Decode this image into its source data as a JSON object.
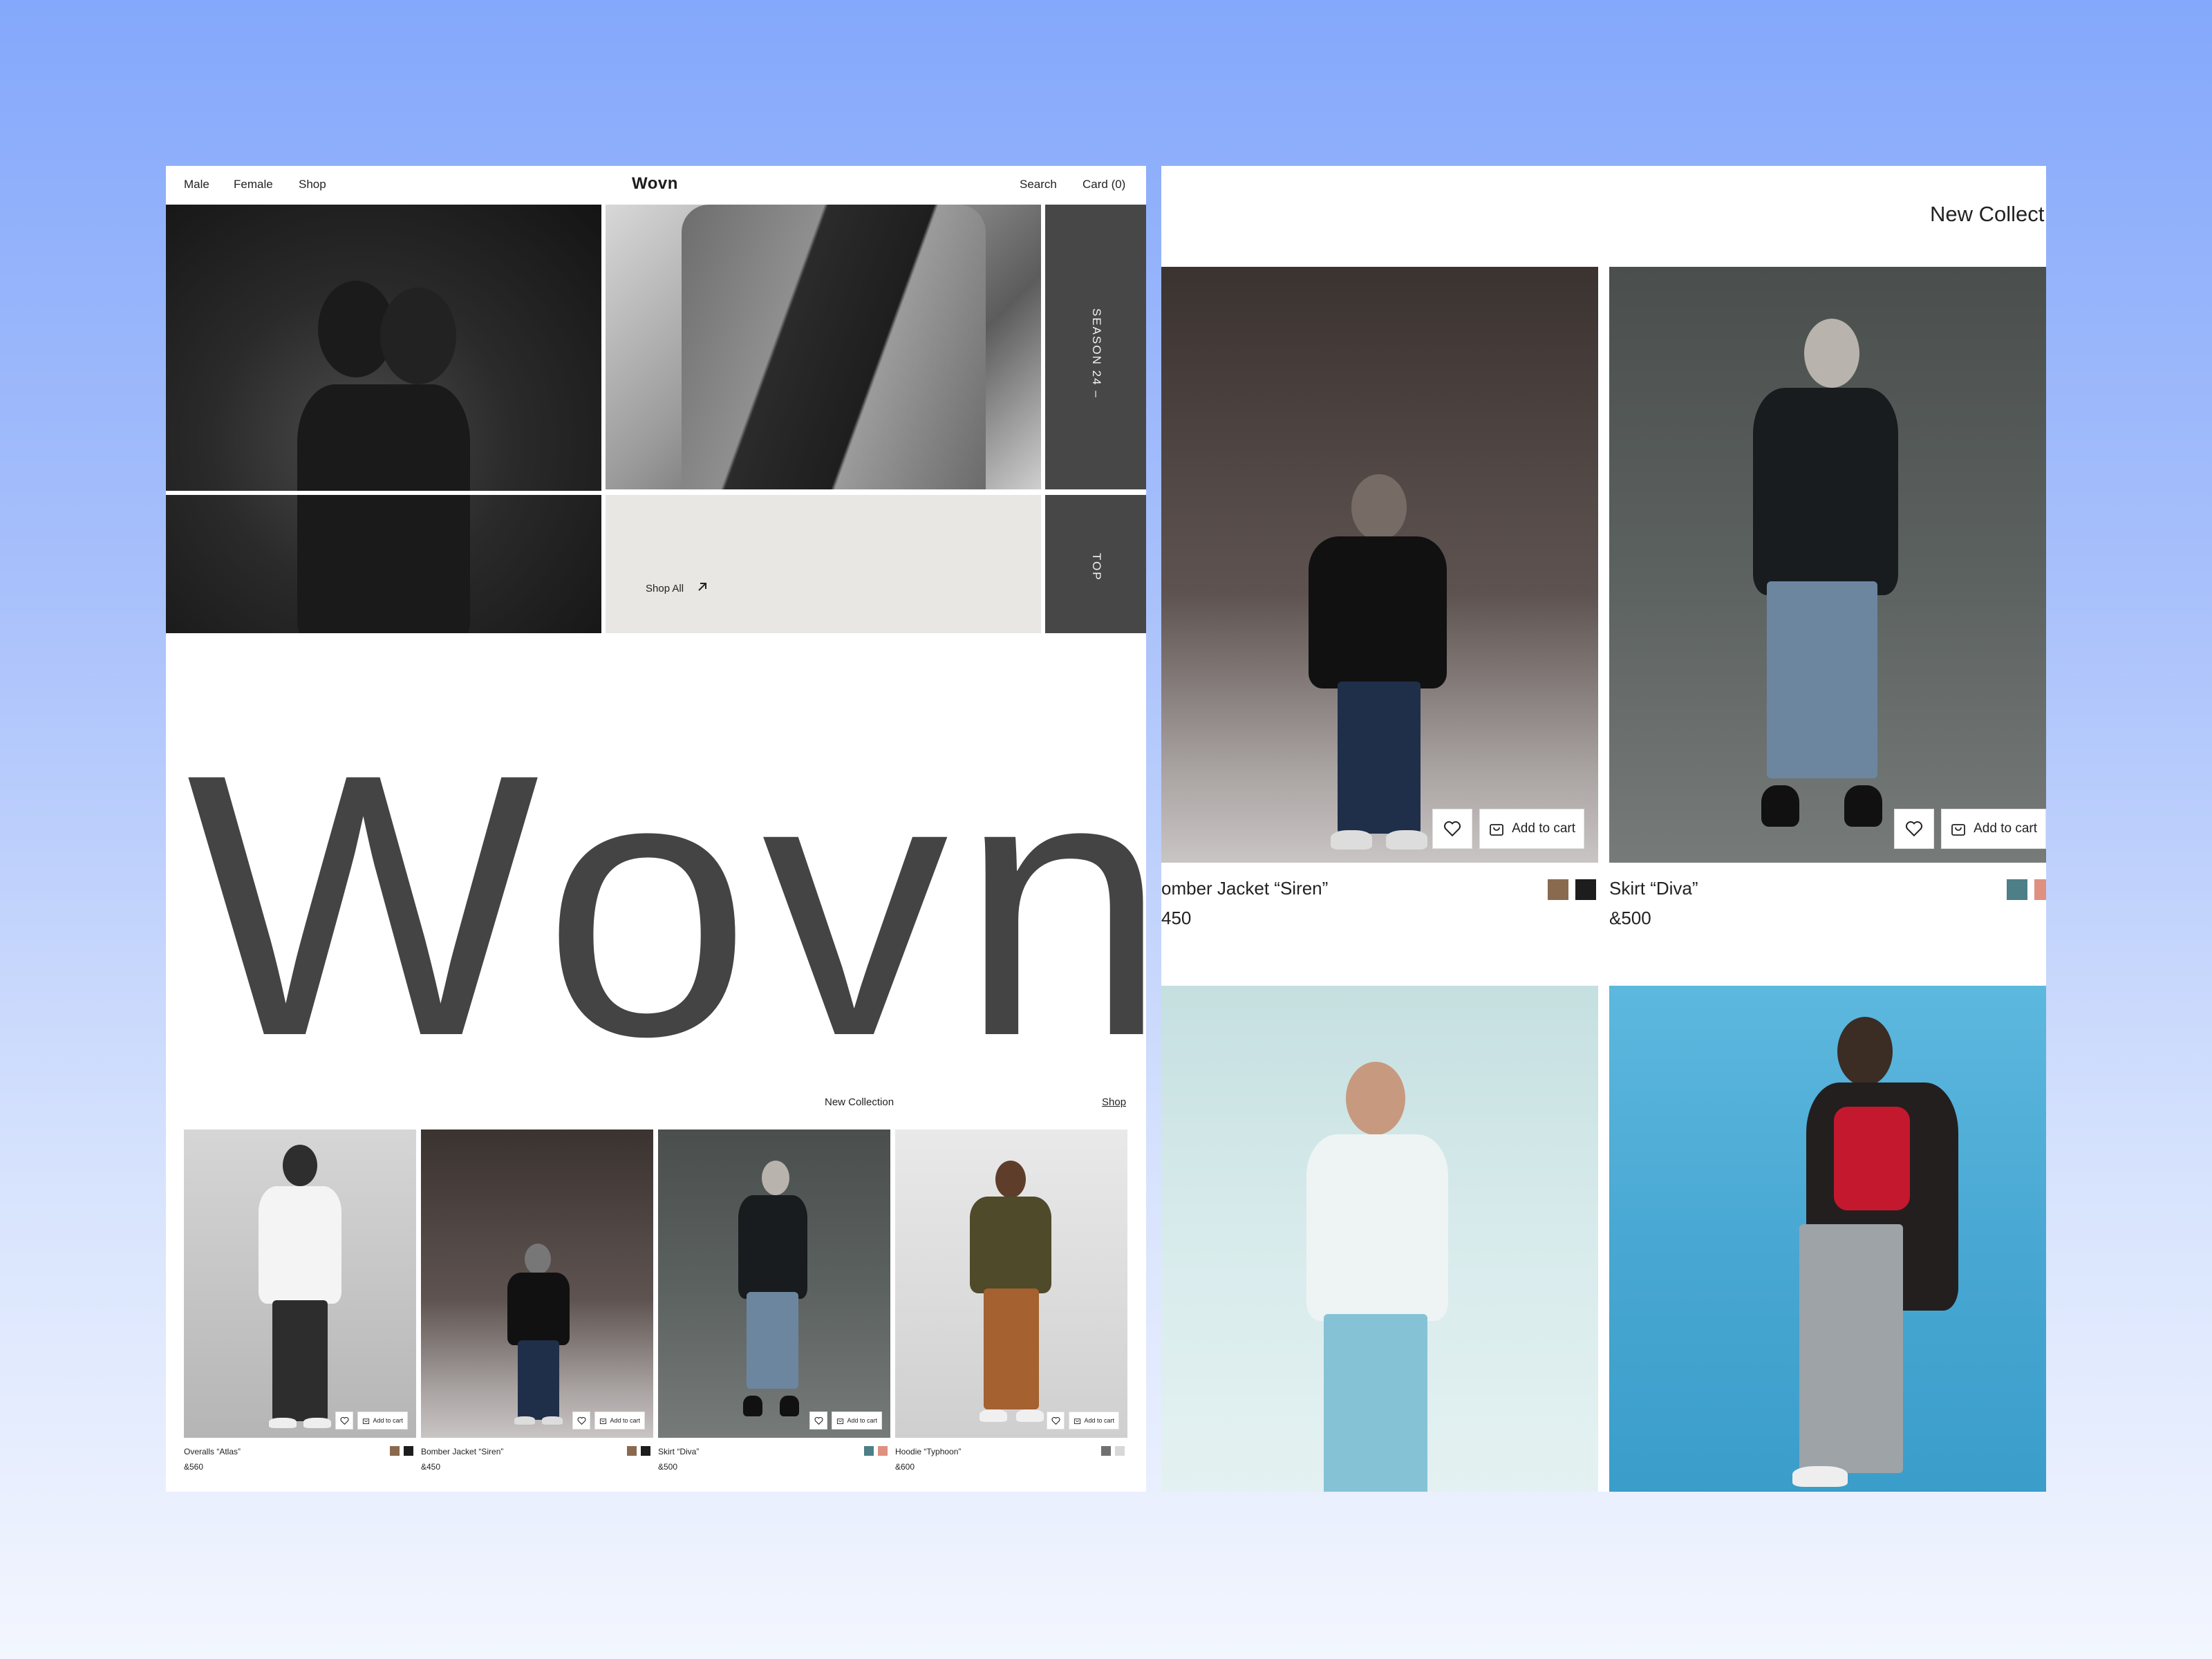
{
  "nav": {
    "links": [
      "Male",
      "Female",
      "Shop"
    ],
    "brand": "Wovn",
    "search": "Search",
    "cart": "Card (0)"
  },
  "hero": {
    "season_label": "SEASON 24 –",
    "top_label": "TOP",
    "shop_all": "Shop All",
    "big_brand": "Wovn"
  },
  "collection": {
    "title": "New Collection",
    "shop_link": "Shop",
    "add_to_cart": "Add to cart",
    "products": [
      {
        "name": "Overalls “Atlas”",
        "price": "&560",
        "swatches": [
          "#8a6a4f",
          "#1d1d1d"
        ]
      },
      {
        "name": "Bomber Jacket “Siren”",
        "price": "&450",
        "swatches": [
          "#8a6a4f",
          "#1d1d1d"
        ]
      },
      {
        "name": "Skirt “Diva”",
        "price": "&500",
        "swatches": [
          "#4d7f86",
          "#e09080"
        ]
      },
      {
        "name": "Hoodie “Typhoon”",
        "price": "&600",
        "swatches": [
          "#707070",
          "#d8d8d8"
        ]
      }
    ]
  },
  "right_panel": {
    "heading": "New Collect",
    "add_to_cart": "Add to cart",
    "products": [
      {
        "name": "omber Jacket “Siren”",
        "price": "450",
        "swatches": [
          "#8a6a4f",
          "#1d1d1d"
        ]
      },
      {
        "name": "Skirt “Diva”",
        "price": "&500",
        "swatches": [
          "#4d7f86",
          "#e09080"
        ]
      }
    ]
  }
}
